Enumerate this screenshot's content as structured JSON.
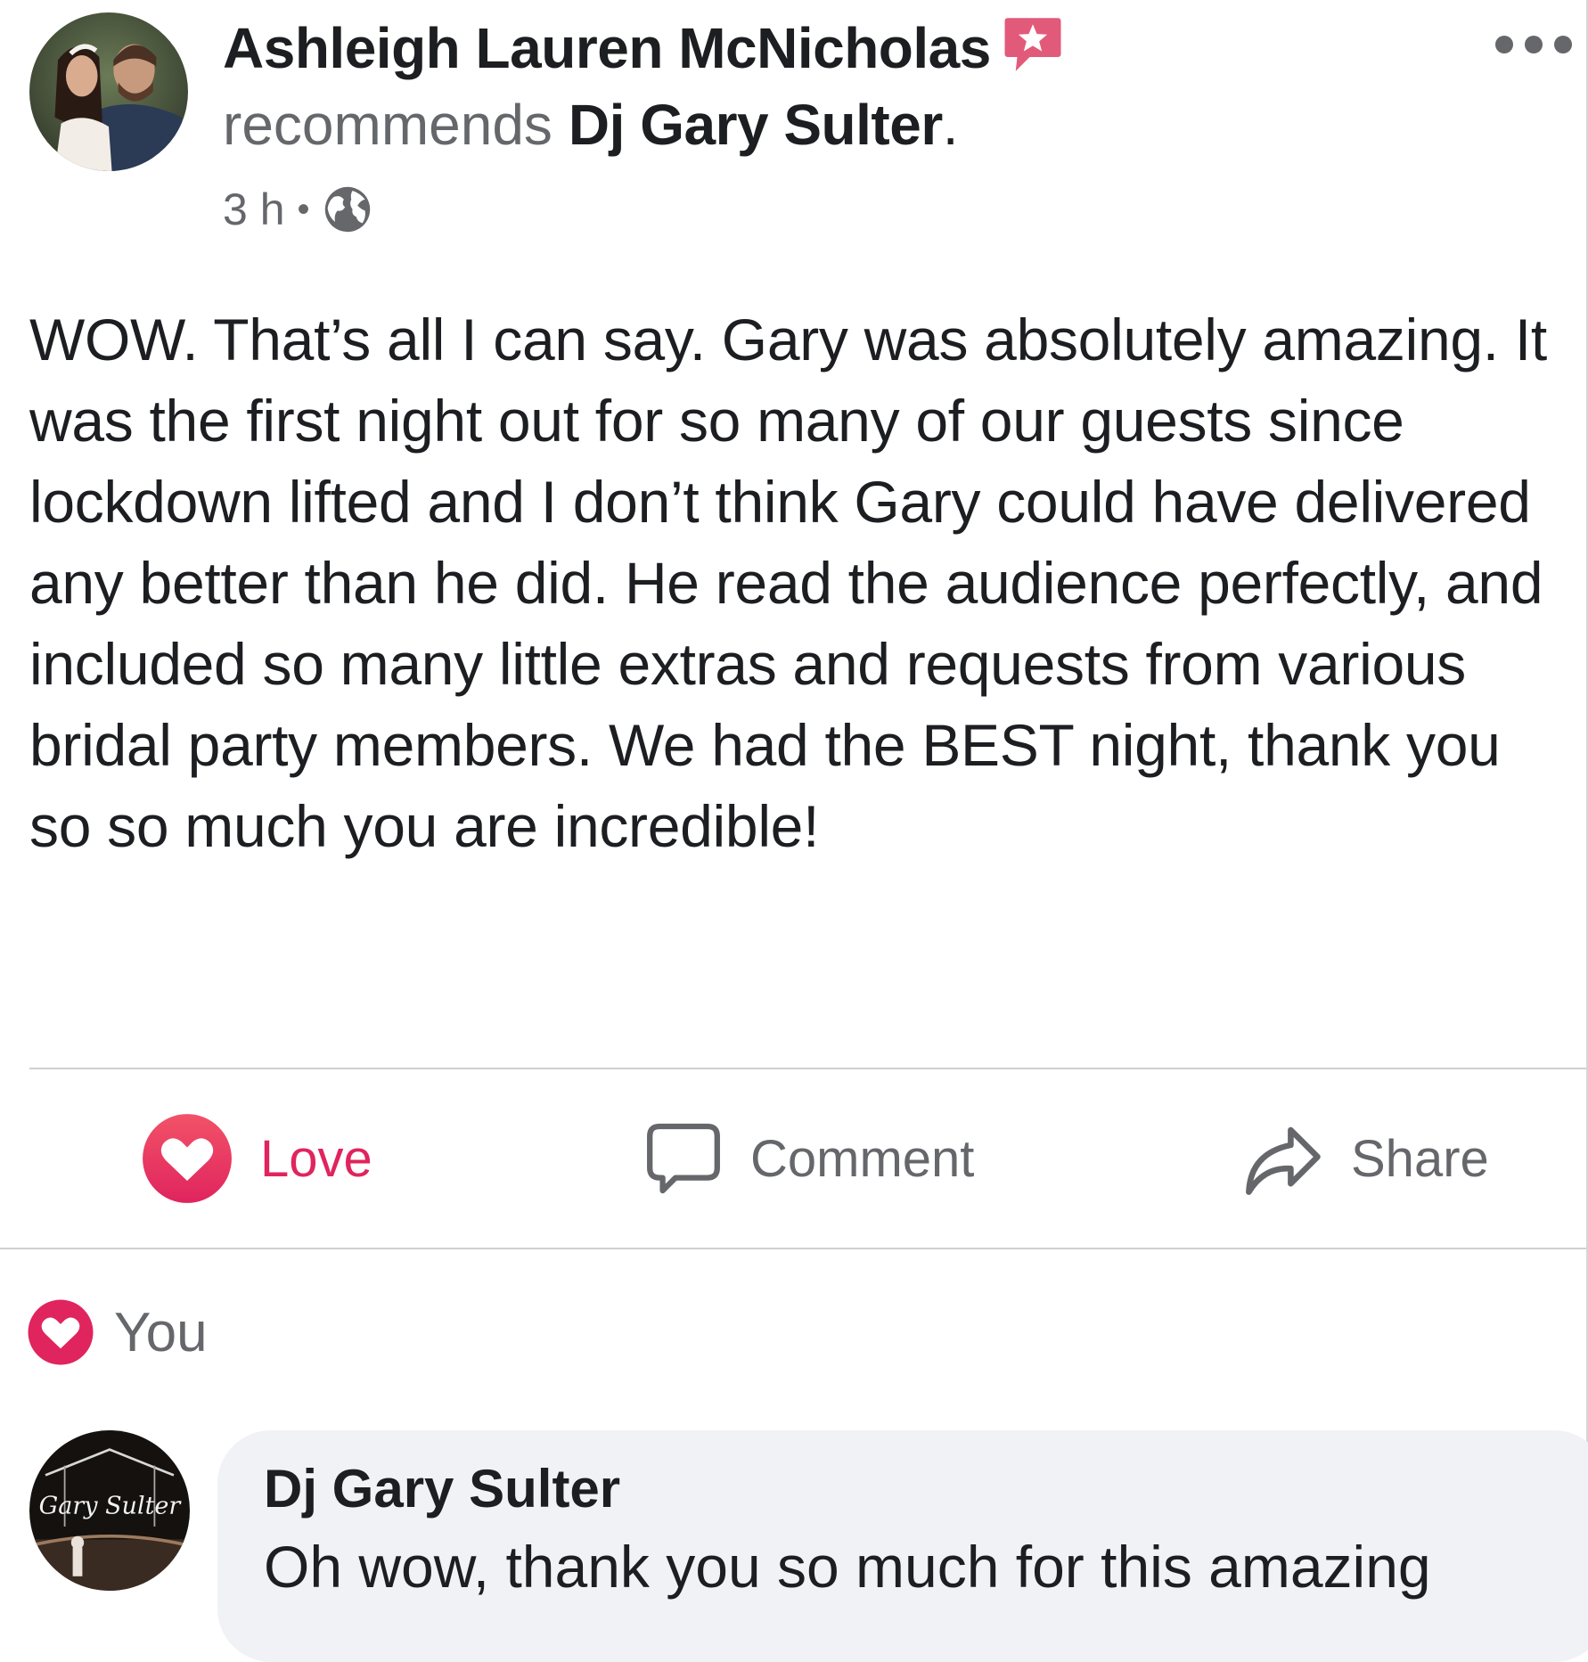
{
  "post": {
    "author": "Ashleigh Lauren McNicholas",
    "action_verb": "recommends",
    "target_page": "Dj Gary Sulter",
    "target_suffix": ".",
    "timestamp": "3 h",
    "separator": "•",
    "audience_icon": "globe-icon",
    "recommendation_badge_icon": "star-speech-bubble-icon",
    "body": "WOW. That’s all I can say. Gary was absolutely amazing. It was the first night out for so many of our guests since lockdown lifted and I don’t think Gary could have delivered any better than he did. He read the audience perfectly, and included so many little extras and requests from various bridal party members. We had the BEST night, thank you so so much you are incredible!"
  },
  "actions": {
    "love_label": "Love",
    "comment_label": "Comment",
    "share_label": "Share"
  },
  "reactions": {
    "summary": "You",
    "icon": "heart-icon"
  },
  "comment": {
    "author": "Dj Gary Sulter",
    "text": "Oh wow, thank you so much for this amazing"
  },
  "colors": {
    "love_accent": "#e0245e",
    "badge": "#e25a7a",
    "secondary_text": "#65676b",
    "bubble_bg": "#f0f2f5",
    "divider": "#ced0d4"
  }
}
